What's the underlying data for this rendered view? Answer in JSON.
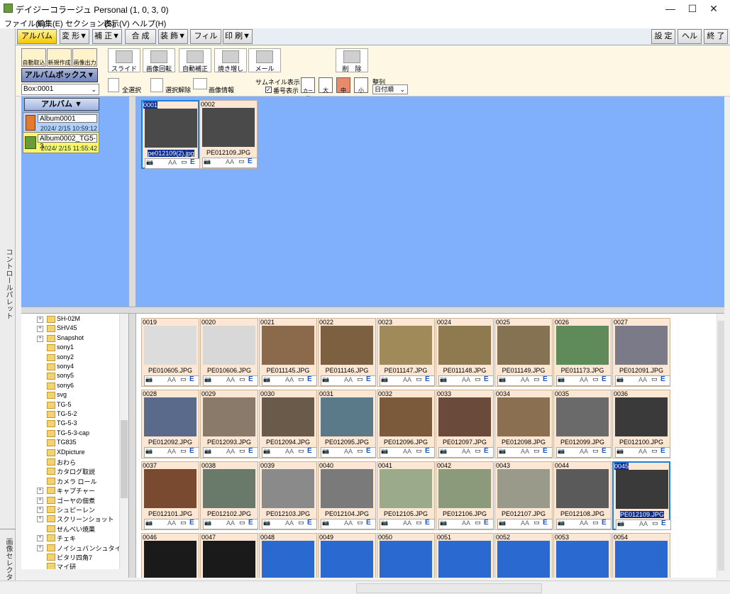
{
  "window": {
    "title": "デイジーコラージュ Personal (1, 0, 3, 0)",
    "minimize": "—",
    "maximize": "☐",
    "close": "✕"
  },
  "menu": [
    "ファイル(F)",
    "編集(E)",
    "セクション(S)",
    "表示(V)",
    "ヘルプ(H)"
  ],
  "tabs": {
    "left": [
      "アルバム",
      "変 形▼",
      "補 正▼",
      "合 成",
      "装 飾▼",
      "フィルタ▼",
      "印 刷▼"
    ],
    "right": [
      "設 定",
      "ヘルプ",
      "終 了"
    ]
  },
  "left_strip": {
    "control_palette": "コントロールパレット",
    "image_selector": "画像セレクタ"
  },
  "left_tools": {
    "buttons": [
      "自動取込",
      "新規作成",
      "画像出力"
    ],
    "album_box": "アルバムボックス▼",
    "box_select": "Box:0001"
  },
  "toolbar": {
    "big_buttons": [
      "スライド",
      "画像回転",
      "自動補正",
      "焼き増し",
      "メール",
      "削　除"
    ],
    "select_all": "全選択",
    "deselect": "選択解除",
    "image_info": "画像情報",
    "thumb_display_label": "サムネイル表示",
    "number_display": "番号表示",
    "size_labels": [
      "カード",
      "大",
      "中",
      "小"
    ],
    "sort_label": "整列",
    "sort_value": "日付順"
  },
  "album_panel": {
    "header": "アルバム ▼",
    "albums": [
      {
        "name": "Album0001",
        "date": "2024/ 2/15 10:59:12"
      },
      {
        "name": "Album0002_TG5-3",
        "date": "2024/ 2/15 11:55:42"
      }
    ]
  },
  "album_images": [
    {
      "num": "0001",
      "file": "pe012109(2).jpg"
    },
    {
      "num": "0002",
      "file": "PE012109.JPG"
    }
  ],
  "folder_tree": [
    "SH-02M",
    "SHV45",
    "Snapshot",
    "sony1",
    "sony2",
    "sony4",
    "sony5",
    "sony6",
    "svg",
    "TG-5",
    "TG-5-2",
    "TG-5-3",
    "TG-5-3-cap",
    "TG835",
    "XDpicture",
    "おわら",
    "カタログ取説",
    "カメラ ロール",
    "キャプチャー",
    "ゴーヤの佃煮",
    "シュピーレン",
    "スクリーンショット",
    "せんべい焼菓",
    "チェキ",
    "ノイシュバンシュタイン",
    "ピタリ四角7",
    "マイ研"
  ],
  "tree_expandable": [
    0,
    1,
    2,
    18,
    19,
    20,
    21,
    23,
    24
  ],
  "thumb_bar": {
    "cam": "📷",
    "aa": "AA",
    "box": "▭",
    "e": "E"
  },
  "thumbnails": [
    {
      "num": "0019",
      "file": "PE010605.JPG",
      "color": "#dcdcdc"
    },
    {
      "num": "0020",
      "file": "PE010606.JPG",
      "color": "#d8d8d8"
    },
    {
      "num": "0021",
      "file": "PE011145.JPG",
      "color": "#8a6a4a"
    },
    {
      "num": "0022",
      "file": "PE011146.JPG",
      "color": "#7d6040"
    },
    {
      "num": "0023",
      "file": "PE011147.JPG",
      "color": "#a08a5a"
    },
    {
      "num": "0024",
      "file": "PE011148.JPG",
      "color": "#8f7a4f"
    },
    {
      "num": "0025",
      "file": "PE011149.JPG",
      "color": "#847252"
    },
    {
      "num": "0026",
      "file": "PE011173.JPG",
      "color": "#5f8a5a"
    },
    {
      "num": "0027",
      "file": "PE012091.JPG",
      "color": "#7a7a88"
    },
    {
      "num": "0028",
      "file": "PE012092.JPG",
      "color": "#5a6a8a"
    },
    {
      "num": "0029",
      "file": "PE012093.JPG",
      "color": "#8a7a6a"
    },
    {
      "num": "0030",
      "file": "PE012094.JPG",
      "color": "#6a5a4a"
    },
    {
      "num": "0031",
      "file": "PE012095.JPG",
      "color": "#5a7a8a"
    },
    {
      "num": "0032",
      "file": "PE012096.JPG",
      "color": "#7a5a3a"
    },
    {
      "num": "0033",
      "file": "PE012097.JPG",
      "color": "#6a4a3a"
    },
    {
      "num": "0034",
      "file": "PE012098.JPG",
      "color": "#8a7050"
    },
    {
      "num": "0035",
      "file": "PE012099.JPG",
      "color": "#6a6a6a"
    },
    {
      "num": "0036",
      "file": "PE012100.JPG",
      "color": "#3a3a3a"
    },
    {
      "num": "0037",
      "file": "PE012101.JPG",
      "color": "#7a4a30"
    },
    {
      "num": "0038",
      "file": "PE012102.JPG",
      "color": "#6a7a6a"
    },
    {
      "num": "0039",
      "file": "PE012103.JPG",
      "color": "#8a8a8a"
    },
    {
      "num": "0040",
      "file": "PE012104.JPG",
      "color": "#7a7a7a"
    },
    {
      "num": "0041",
      "file": "PE012105.JPG",
      "color": "#9aaa8a"
    },
    {
      "num": "0042",
      "file": "PE012106.JPG",
      "color": "#8a9a7a"
    },
    {
      "num": "0043",
      "file": "PE012107.JPG",
      "color": "#9a9a8a"
    },
    {
      "num": "0044",
      "file": "PE012108.JPG",
      "color": "#5a5a5a"
    },
    {
      "num": "0045",
      "file": "PE012109.JPG",
      "color": "#3a3a3a",
      "selected": true
    },
    {
      "num": "0046",
      "file": "",
      "color": "#1a1a1a"
    },
    {
      "num": "0047",
      "file": "",
      "color": "#1a1a1a"
    },
    {
      "num": "0048",
      "file": "",
      "color": "#2a6ad0"
    },
    {
      "num": "0049",
      "file": "",
      "color": "#2a6ad0"
    },
    {
      "num": "0050",
      "file": "",
      "color": "#2a6ad0"
    },
    {
      "num": "0051",
      "file": "",
      "color": "#2a6ad0"
    },
    {
      "num": "0052",
      "file": "",
      "color": "#2a6ad0"
    },
    {
      "num": "0053",
      "file": "",
      "color": "#2a6ad0"
    },
    {
      "num": "0054",
      "file": "",
      "color": "#2a6ad0"
    }
  ]
}
